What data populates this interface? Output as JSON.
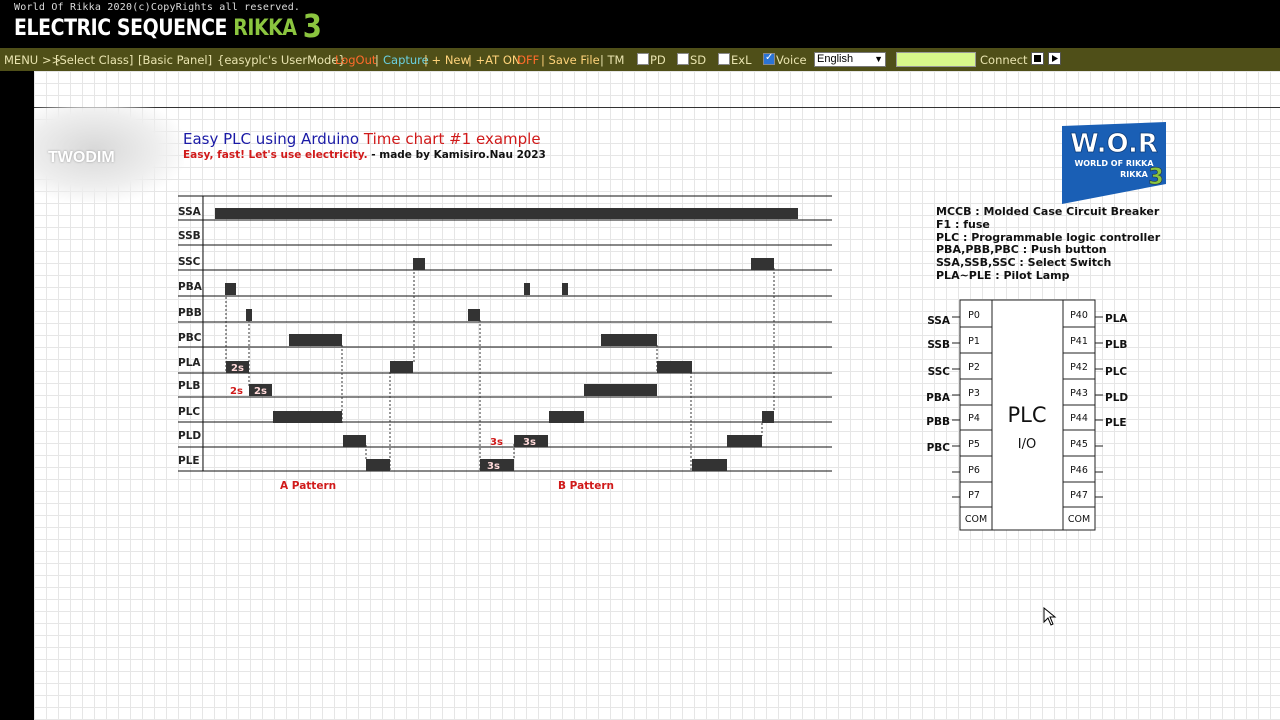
{
  "header": {
    "copyright": "World Of Rikka 2020(c)CopyRights all reserved.",
    "title_white": "ELECTRIC SEQUENCE ",
    "title_green": "RIKKA",
    "title_num": "3"
  },
  "menu": {
    "menu_label": "MENU >>",
    "select_class": "[Select Class]",
    "basic_panel": "[Basic Panel]",
    "user_mode": "{easyplc's UserMode}",
    "logout": "LogOut",
    "sep1": "|",
    "capture": "Capture",
    "new": "| + New",
    "at_on": "| +AT ON",
    "off": "OFF",
    "save_file": "| Save File",
    "tm": "| TM",
    "pd": "PD",
    "sd": "SD",
    "exl": "ExL",
    "voice": "Voice",
    "language": "English",
    "connect": "Connect",
    "checks": {
      "pd": false,
      "sd": false,
      "exl": false,
      "voice": true
    }
  },
  "watermark": "TWODIM",
  "doc": {
    "title_a": "Easy PLC using Arduino ",
    "title_b": "Time chart #1 example",
    "sub_a": "Easy, fast! Let's use electricity.",
    "sub_b": " - made by Kamisiro.Nau 2023"
  },
  "logo": {
    "line1": "W.O.R",
    "line2": "WORLD OF RIKKA",
    "line3": "RIKKA",
    "num": "3"
  },
  "legend": [
    "MCCB : Molded Case Circuit Breaker",
    "F1 : fuse",
    "PLC : Programmable logic controller",
    "PBA,PBB,PBC : Push button",
    "SSA,SSB,SSC : Select Switch",
    "PLA~PLE : Pilot Lamp"
  ],
  "timing": {
    "rows": [
      "SSA",
      "SSB",
      "SSC",
      "PBA",
      "PBB",
      "PBC",
      "PLA",
      "PLB",
      "PLC",
      "PLD",
      "PLE"
    ],
    "pattern_a": "A Pattern",
    "pattern_b": "B Pattern",
    "labels": [
      "2s",
      "2s",
      "2s",
      "3s",
      "3s",
      "3s"
    ]
  },
  "plc": {
    "title": "PLC",
    "subtitle": "I/O",
    "left_ports": [
      "P0",
      "P1",
      "P2",
      "P3",
      "P4",
      "P5",
      "P6",
      "P7",
      "COM"
    ],
    "right_ports": [
      "P40",
      "P41",
      "P42",
      "P43",
      "P44",
      "P45",
      "P46",
      "P47",
      "COM"
    ],
    "inputs": [
      "SSA",
      "SSB",
      "SSC",
      "PBA",
      "PBB",
      "PBC"
    ],
    "outputs": [
      "PLA",
      "PLB",
      "PLC",
      "PLD",
      "PLE"
    ]
  }
}
